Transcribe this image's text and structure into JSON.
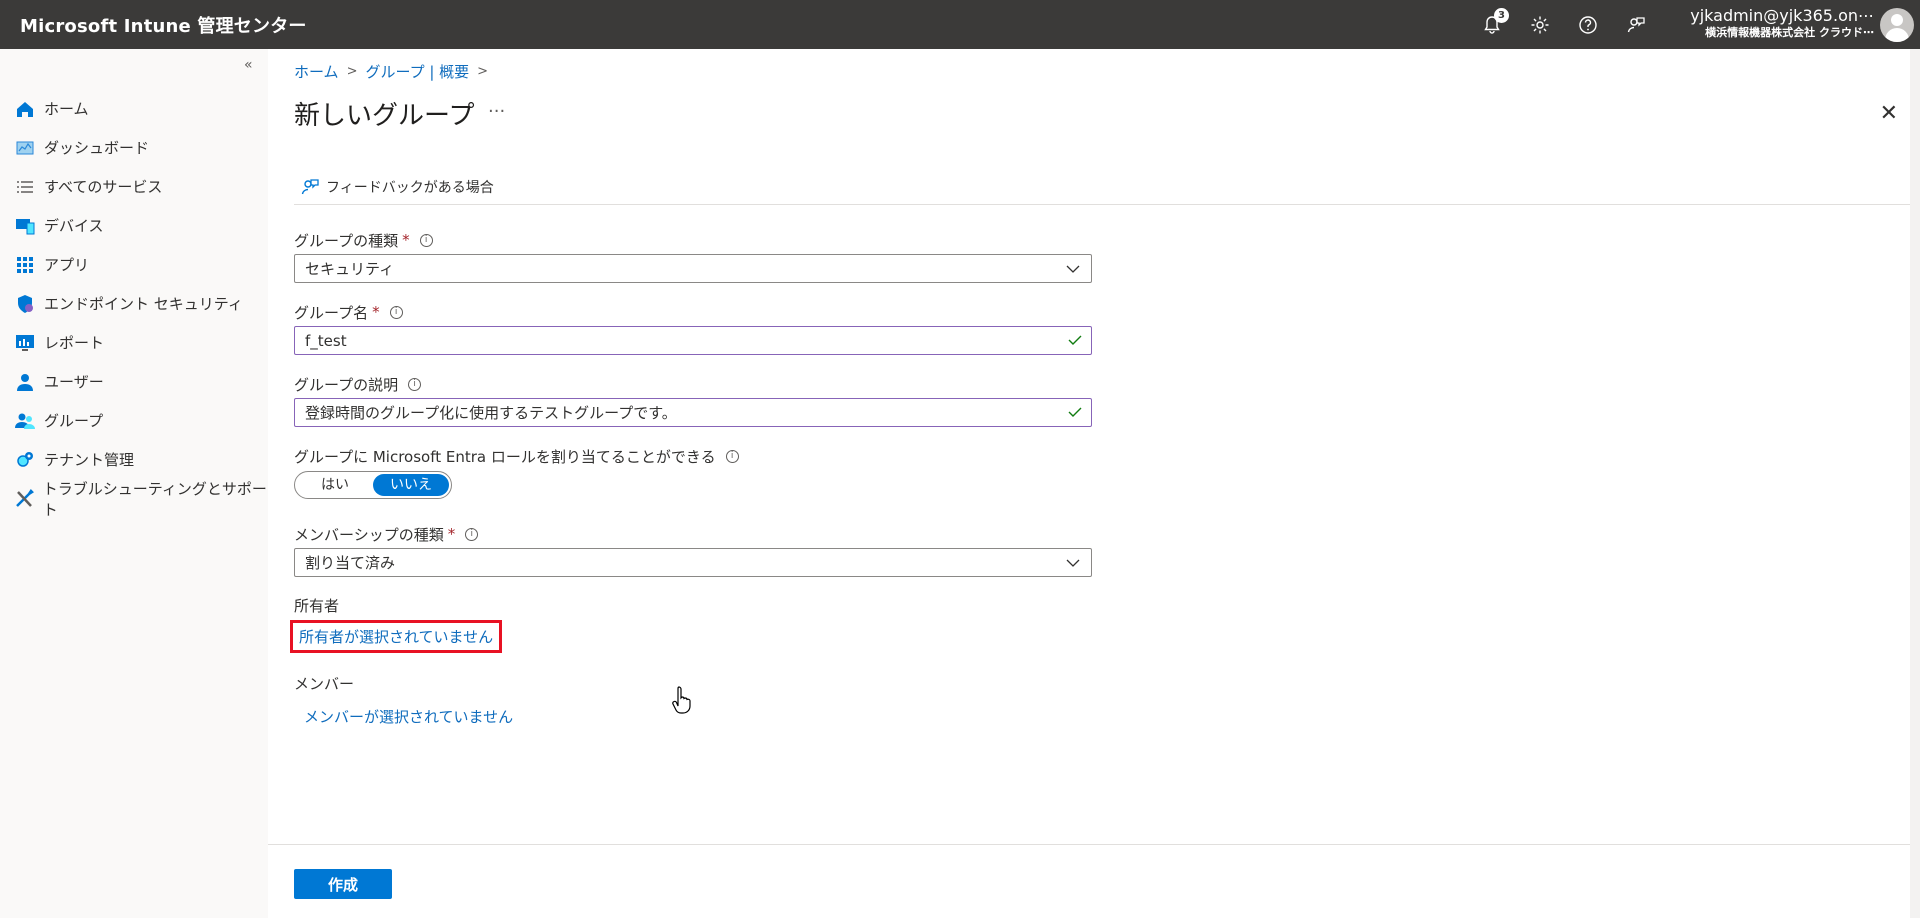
{
  "app": {
    "title": "Microsoft Intune 管理センター",
    "notification_count": "3",
    "account_name": "yjkadmin@yjk365.on⋯",
    "account_org": "横浜情報機器株式会社 クラウド⋯"
  },
  "sidebar": {
    "collapse_glyph": "«",
    "items": [
      {
        "label": "ホーム",
        "icon": "home-icon"
      },
      {
        "label": "ダッシュボード",
        "icon": "dashboard-icon"
      },
      {
        "label": "すべてのサービス",
        "icon": "list-icon"
      },
      {
        "label": "デバイス",
        "icon": "devices-icon"
      },
      {
        "label": "アプリ",
        "icon": "apps-grid-icon"
      },
      {
        "label": "エンドポイント セキュリティ",
        "icon": "shield-icon"
      },
      {
        "label": "レポート",
        "icon": "report-icon"
      },
      {
        "label": "ユーザー",
        "icon": "user-icon"
      },
      {
        "label": "グループ",
        "icon": "group-icon"
      },
      {
        "label": "テナント管理",
        "icon": "tenant-icon"
      },
      {
        "label": "トラブルシューティングとサポート",
        "icon": "tools-icon"
      }
    ]
  },
  "breadcrumb": [
    "ホーム",
    "グループ | 概要"
  ],
  "page": {
    "title": "新しいグループ",
    "ellipsis": "···",
    "close": "✕",
    "feedback": "フィードバックがある場合"
  },
  "form": {
    "group_type": {
      "label": "グループの種類",
      "value": "セキュリティ"
    },
    "group_name": {
      "label": "グループ名",
      "value": "f_test"
    },
    "group_description": {
      "label": "グループの説明",
      "value": "登録時間のグループ化に使用するテストグループです。"
    },
    "entra_role": {
      "label": "グループに Microsoft Entra ロールを割り当てることができる",
      "yes": "はい",
      "no": "いいえ",
      "selected": "いいえ"
    },
    "membership_type": {
      "label": "メンバーシップの種類",
      "value": "割り当て済み"
    },
    "owners": {
      "label": "所有者",
      "link": "所有者が選択されていません"
    },
    "members": {
      "label": "メンバー",
      "link": "メンバーが選択されていません"
    },
    "required_mark": "*",
    "info_mark": "i"
  },
  "footer": {
    "create_label": "作成"
  },
  "colors": {
    "accent": "#0078d4",
    "link": "#0f6cbd",
    "highlight": "#e81123",
    "topbar": "#3b3a39"
  }
}
